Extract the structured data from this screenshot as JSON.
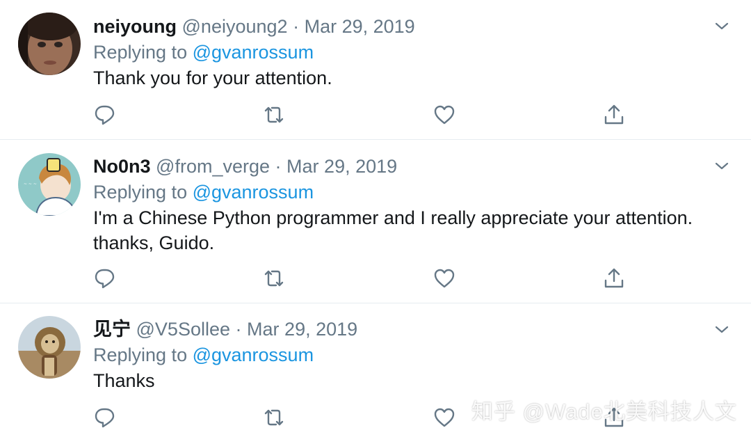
{
  "tweets": [
    {
      "name": "neiyoung",
      "handle": "@neiyoung2",
      "dot": "·",
      "date": "Mar 29, 2019",
      "replying_prefix": "Replying to ",
      "replying_mention": "@gvanrossum",
      "text": "Thank you for your attention."
    },
    {
      "name": "No0n3",
      "handle": "@from_verge",
      "dot": "·",
      "date": "Mar 29, 2019",
      "replying_prefix": "Replying to ",
      "replying_mention": "@gvanrossum",
      "text": "I'm a Chinese Python programmer and I really appreciate your attention. thanks, Guido."
    },
    {
      "name": "见宁",
      "handle": "@V5Sollee",
      "dot": "·",
      "date": "Mar 29, 2019",
      "replying_prefix": "Replying to ",
      "replying_mention": "@gvanrossum",
      "text": "Thanks"
    }
  ],
  "watermark": "知乎 @Wade北美科技人文",
  "colors": {
    "text": "#14171a",
    "secondary": "#657786",
    "link": "#1b95e0",
    "divider": "#e6ecf0"
  },
  "icons": [
    "reply-icon",
    "retweet-icon",
    "like-icon",
    "share-icon",
    "chevron-down-icon"
  ]
}
